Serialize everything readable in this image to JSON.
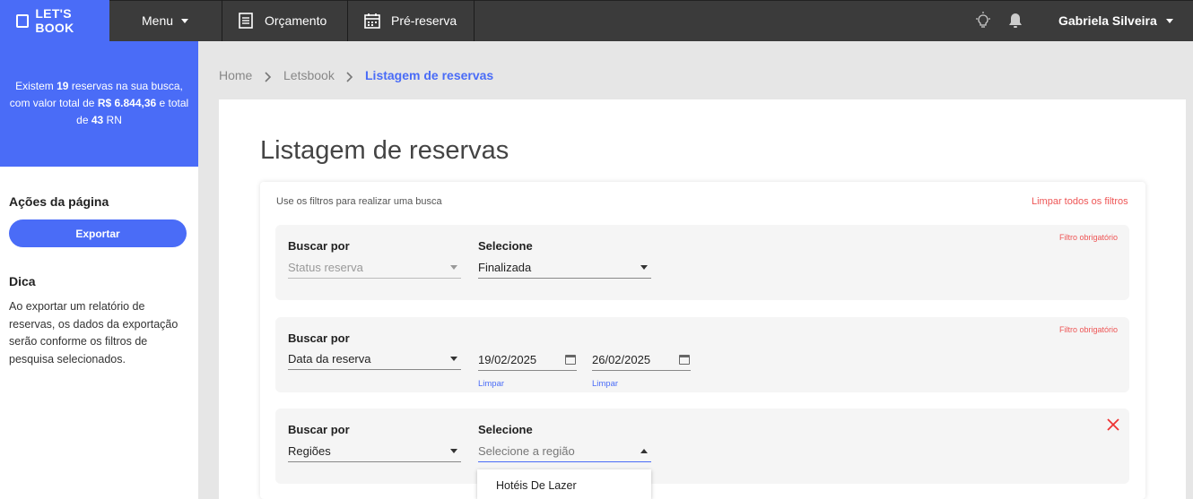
{
  "topbar": {
    "logo": "LET'S BOOK",
    "menu": "Menu",
    "orcamento": "Orçamento",
    "prereserva": "Pré-reserva",
    "user": "Gabriela Silveira"
  },
  "summary": {
    "p1": "Existem ",
    "count": "19",
    "p2": " reservas na sua busca, com valor total de ",
    "value": "R$ 6.844,36",
    "p3": " e total de ",
    "rn": "43",
    "p4": " RN"
  },
  "sidebar": {
    "actions_title": "Ações da página",
    "export": "Exportar",
    "tip_title": "Dica",
    "tip_text": "Ao exportar um relatório de reservas, os dados da exportação serão conforme os filtros de pesquisa selecionados."
  },
  "breadcrumb": {
    "home": "Home",
    "letsbook": "Letsbook",
    "current": "Listagem de reservas"
  },
  "page": {
    "title": "Listagem de reservas"
  },
  "filters": {
    "hint": "Use os filtros para realizar uma busca",
    "clear_all": "Limpar todos os filtros",
    "required": "Filtro obrigatório",
    "search_by": "Buscar por",
    "select": "Selecione",
    "f1": {
      "search_value": "Status reserva",
      "select_value": "Finalizada"
    },
    "f2": {
      "search_value": "Data da reserva",
      "date_from": "19/02/2025",
      "date_to": "26/02/2025",
      "clear": "Limpar"
    },
    "f3": {
      "search_value": "Regiões",
      "select_placeholder": "Selecione a região",
      "options": [
        "Hotéis De Lazer"
      ]
    }
  }
}
